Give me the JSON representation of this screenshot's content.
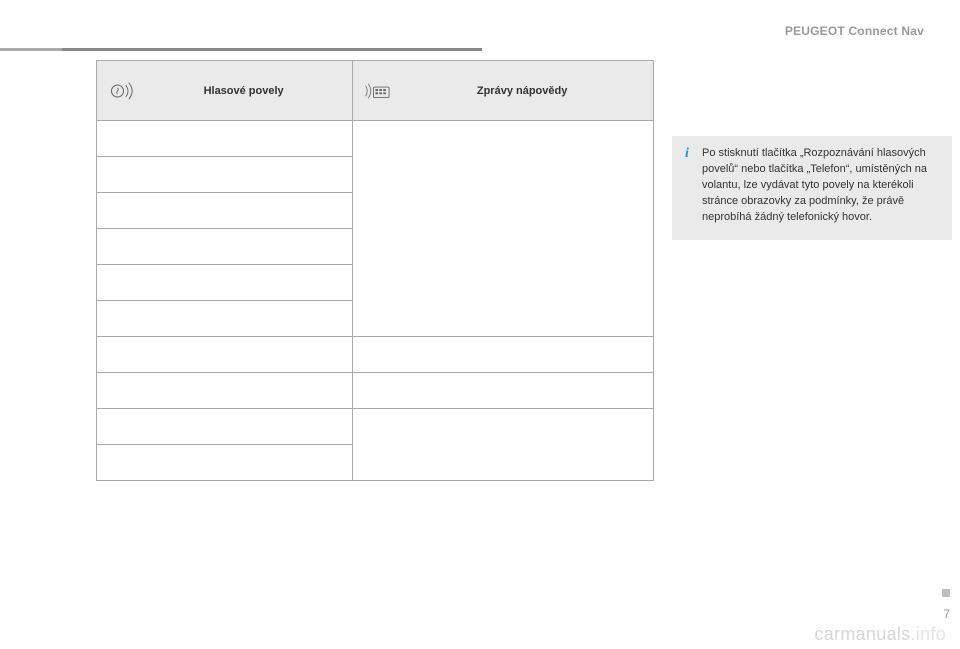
{
  "brand": "PEUGEOT Connect Nav",
  "table": {
    "headers": {
      "voice": "Hlasové povely",
      "help": "Zprávy nápovědy"
    }
  },
  "info": {
    "text": "Po stisknutí tlačítka „Rozpoznávání hlasových povelů“ nebo tlačítka „Telefon“, umístěných na volantu, lze vydávat tyto povely na kterékoli stránce obrazovky za podmínky, že právě neprobíhá žádný telefonický hovor."
  },
  "page_number": "7",
  "watermark": {
    "a": "carmanuals",
    "b": ".info"
  }
}
